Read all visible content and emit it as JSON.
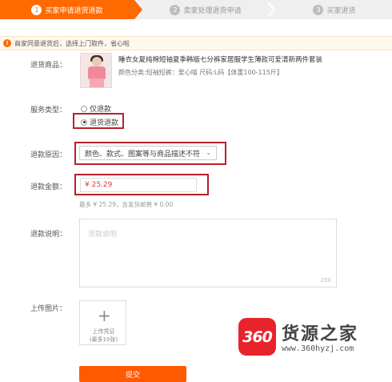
{
  "steps": [
    {
      "num": "1",
      "label": "买家申请退货退款"
    },
    {
      "num": "2",
      "label": "卖家处理退货申请"
    },
    {
      "num": "3",
      "label": "买家退货"
    }
  ],
  "notice": {
    "icon": "!",
    "text": "商家同意退货后，选择上门取件，省心啦"
  },
  "product": {
    "label": "退货商品：",
    "title": "睡衣女夏纯棉短袖夏季韩版七分裤家居服学生薄款可爱清新两件套装",
    "spec": "颜色分类:短袖短裤：爱心喵    尺码:L码【体重100-115斤】"
  },
  "service": {
    "label": "服务类型：",
    "options": [
      "仅退款",
      "退货退款"
    ],
    "selected": "退货退款"
  },
  "reason": {
    "label": "退款原因：",
    "value": "颜色、款式、图案等与商品描述不符"
  },
  "amount": {
    "label": "退款金额：",
    "value": "¥ 25.29",
    "hint": "最多 ¥ 25.29，含发货邮费 ¥ 0.00"
  },
  "description": {
    "label": "退款说明：",
    "placeholder": "退款说明",
    "counter": "200"
  },
  "upload": {
    "label": "上传图片：",
    "line1": "上传凭证",
    "line2": "(最多10张)"
  },
  "submit_label": "提交",
  "watermark": {
    "badge": "360",
    "name": "货源之家",
    "url": "www.360hyzj.com"
  },
  "colors": {
    "accent": "#ff6a00",
    "highlight_box": "#b8202a",
    "price": "#e4393c"
  }
}
